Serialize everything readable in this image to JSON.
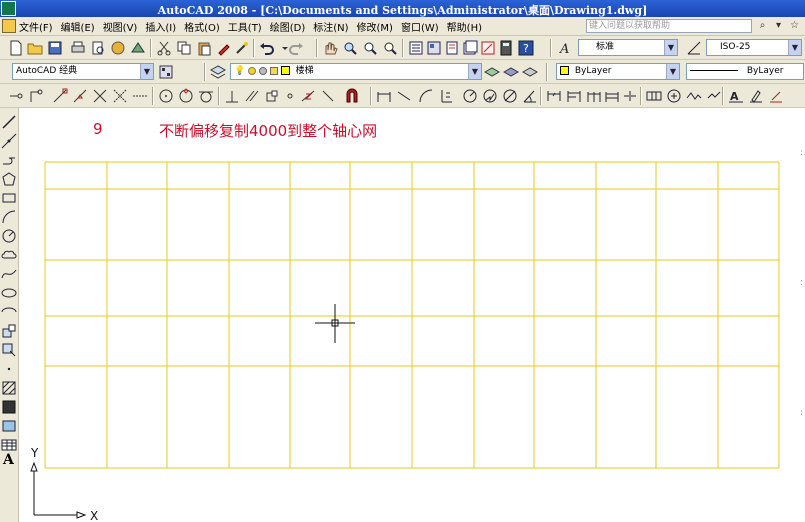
{
  "window": {
    "title": "AutoCAD 2008 - [C:\\Documents and Settings\\Administrator\\桌面\\Drawing1.dwg]"
  },
  "menubar": {
    "items": [
      "文件(F)",
      "编辑(E)",
      "视图(V)",
      "插入(I)",
      "格式(O)",
      "工具(T)",
      "绘图(D)",
      "标注(N)",
      "修改(M)",
      "窗口(W)",
      "帮助(H)"
    ],
    "help_search_placeholder": "键入问题以获取帮助"
  },
  "styles_toolbar": {
    "text_style": "标准",
    "dim_style": "ISO-25"
  },
  "workspace_toolbar": {
    "workspace": "AutoCAD 经典",
    "layer": "楼梯"
  },
  "properties_toolbar": {
    "color": "ByLayer",
    "linetype": "ByLayer",
    "color_value": "#ffff00"
  },
  "annotation": {
    "step": "9",
    "text": "不断偏移复制4000到整个轴心网"
  },
  "ucs": {
    "x_label": "X",
    "y_label": "Y"
  },
  "left_toolbar": {
    "text_tool": "A"
  },
  "drawing": {
    "grid_color": "#e8c820"
  }
}
